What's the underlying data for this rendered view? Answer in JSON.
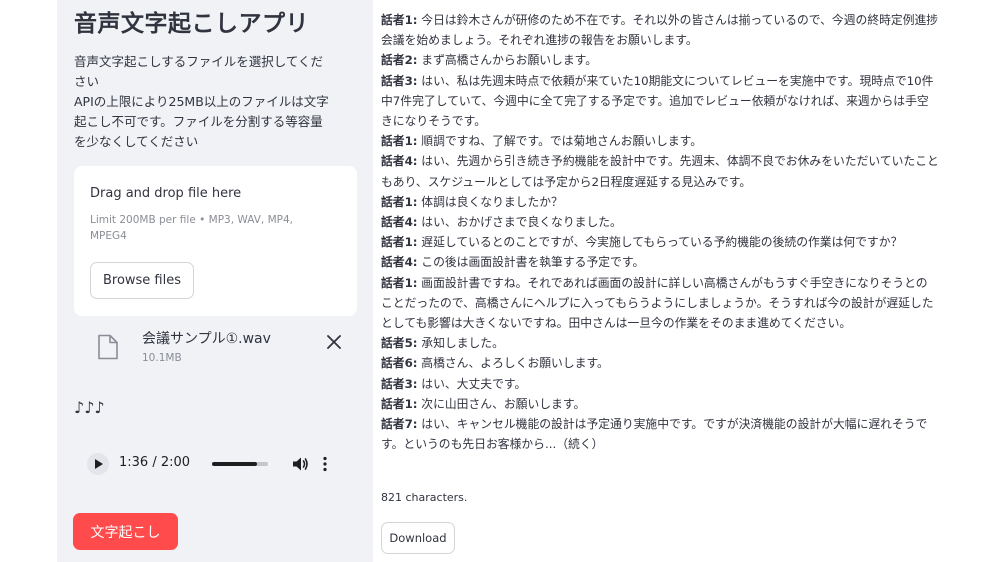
{
  "sidebar": {
    "title": "音声文字起こしアプリ",
    "description_lines": [
      "音声文字起こしするファイルを選択してくだ",
      "さい",
      "APIの上限により25MB以上のファイルは文字",
      "起こし不可です。ファイルを分割する等容量",
      "を少なくしてください"
    ],
    "uploader": {
      "drop_text": "Drag and drop file here",
      "limit_text": "Limit 200MB per file • MP3, WAV, MP4, MPEG4",
      "browse_label": "Browse files"
    },
    "file": {
      "name": "会議サンプル①.wav",
      "size": "10.1MB",
      "icon": "file-icon",
      "remove_icon": "close-icon"
    },
    "notes_text": "♪♪♪",
    "audio": {
      "time": "1:36 / 2:00",
      "progress": 0.8,
      "icons": [
        "play-icon",
        "volume-icon",
        "more-vert-icon"
      ]
    },
    "transcribe_label": "文字起こし"
  },
  "main": {
    "transcript": [
      {
        "speaker": "話者1:",
        "text": " 今日は鈴木さんが研修のため不在です。それ以外の皆さんは揃っているので、今週の終時定例進捗会議を始めましょう。それぞれ進捗の報告をお願いします。"
      },
      {
        "speaker": "話者2:",
        "text": " まず高橋さんからお願いします。"
      },
      {
        "speaker": "話者3:",
        "text": " はい、私は先週末時点で依頼が来ていた10期能文についてレビューを実施中です。現時点で10件中7件完了していて、今週中に全て完了する予定です。追加でレビュー依頼がなければ、来週からは手空きになりそうです。"
      },
      {
        "speaker": "話者1:",
        "text": " 順調ですね、了解です。では菊地さんお願いします。"
      },
      {
        "speaker": "話者4:",
        "text": " はい、先週から引き続き予約機能を設計中です。先週末、体調不良でお休みをいただいていたこともあり、スケジュールとしては予定から2日程度遅延する見込みです。"
      },
      {
        "speaker": "話者1:",
        "text": " 体調は良くなりましたか？"
      },
      {
        "speaker": "話者4:",
        "text": " はい、おかげさまで良くなりました。"
      },
      {
        "speaker": "話者1:",
        "text": " 遅延しているとのことですが、今実施してもらっている予約機能の後続の作業は何ですか？"
      },
      {
        "speaker": "話者4:",
        "text": " この後は画面設計書を執筆する予定です。"
      },
      {
        "speaker": "話者1:",
        "text": " 画面設計書ですね。それであれば画面の設計に詳しい高橋さんがもうすぐ手空きになりそうとのことだったので、高橋さんにヘルプに入ってもらうようにしましょうか。そうすれば今の設計が遅延したとしても影響は大きくないですね。田中さんは一旦今の作業をそのまま進めてください。"
      },
      {
        "speaker": "話者5:",
        "text": " 承知しました。"
      },
      {
        "speaker": "話者6:",
        "text": " 高橋さん、よろしくお願いします。"
      },
      {
        "speaker": "話者3:",
        "text": " はい、大丈夫です。"
      },
      {
        "speaker": "話者1:",
        "text": " 次に山田さん、お願いします。"
      },
      {
        "speaker": "話者7:",
        "text": " はい、キャンセル機能の設計は予定通り実施中です。ですが決済機能の設計が大幅に遅れそうです。というのも先日お客様から...（続く）"
      }
    ],
    "char_count": "821 characters.",
    "download_label": "Download"
  },
  "colors": {
    "sidebar_bg": "#f0f2f6",
    "primary": "#ff4b4b",
    "text": "#31333f",
    "muted": "#8b8d96"
  }
}
